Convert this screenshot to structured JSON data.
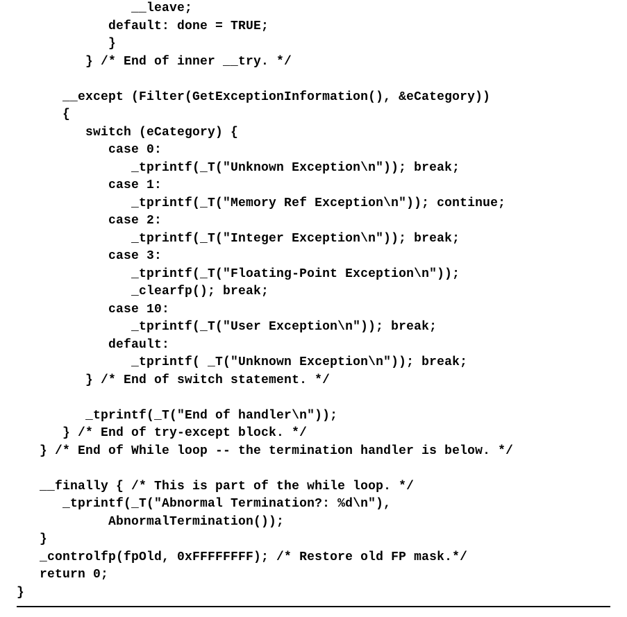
{
  "code": {
    "lines": [
      "               __leave;",
      "            default: done = TRUE;",
      "            }",
      "         } /* End of inner __try. */",
      "",
      "      __except (Filter(GetExceptionInformation(), &eCategory))",
      "      {",
      "         switch (eCategory) {",
      "            case 0:",
      "               _tprintf(_T(\"Unknown Exception\\n\")); break;",
      "            case 1:",
      "               _tprintf(_T(\"Memory Ref Exception\\n\")); continue;",
      "            case 2:",
      "               _tprintf(_T(\"Integer Exception\\n\")); break;",
      "            case 3:",
      "               _tprintf(_T(\"Floating-Point Exception\\n\"));",
      "               _clearfp(); break;",
      "            case 10:",
      "               _tprintf(_T(\"User Exception\\n\")); break;",
      "            default:",
      "               _tprintf( _T(\"Unknown Exception\\n\")); break;",
      "         } /* End of switch statement. */",
      "",
      "         _tprintf(_T(\"End of handler\\n\"));",
      "      } /* End of try-except block. */",
      "   } /* End of While loop -- the termination handler is below. */",
      "",
      "   __finally { /* This is part of the while loop. */",
      "      _tprintf(_T(\"Abnormal Termination?: %d\\n\"),",
      "            AbnormalTermination());",
      "   }",
      "   _controlfp(fpOld, 0xFFFFFFFF); /* Restore old FP mask.*/",
      "   return 0;",
      "}"
    ]
  }
}
